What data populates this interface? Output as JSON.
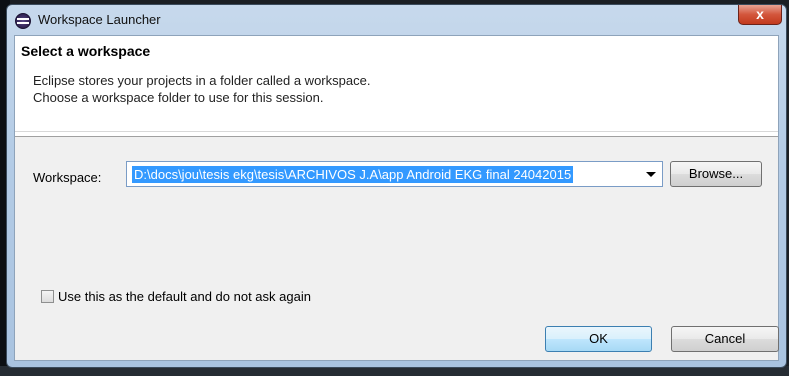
{
  "window": {
    "title": "Workspace Launcher",
    "close_glyph": "x"
  },
  "banner": {
    "title": "Select a workspace",
    "line1": "Eclipse stores your projects in a folder called a workspace.",
    "line2": "Choose a workspace folder to use for this session."
  },
  "workspace": {
    "label": "Workspace:",
    "value": "D:\\docs\\jou\\tesis ekg\\tesis\\ARCHIVOS J.A\\app Android EKG final 24042015",
    "browse_label": "Browse..."
  },
  "default_checkbox": {
    "label": "Use this as the default and do not ask again",
    "checked": false
  },
  "buttons": {
    "ok": "OK",
    "cancel": "Cancel"
  },
  "icons": {
    "app": "eclipse-icon",
    "close": "close-icon",
    "dropdown": "chevron-down-icon"
  },
  "colors": {
    "selection": "#3399ff",
    "close_button": "#c23a1d",
    "frame": "#b4cce6"
  }
}
